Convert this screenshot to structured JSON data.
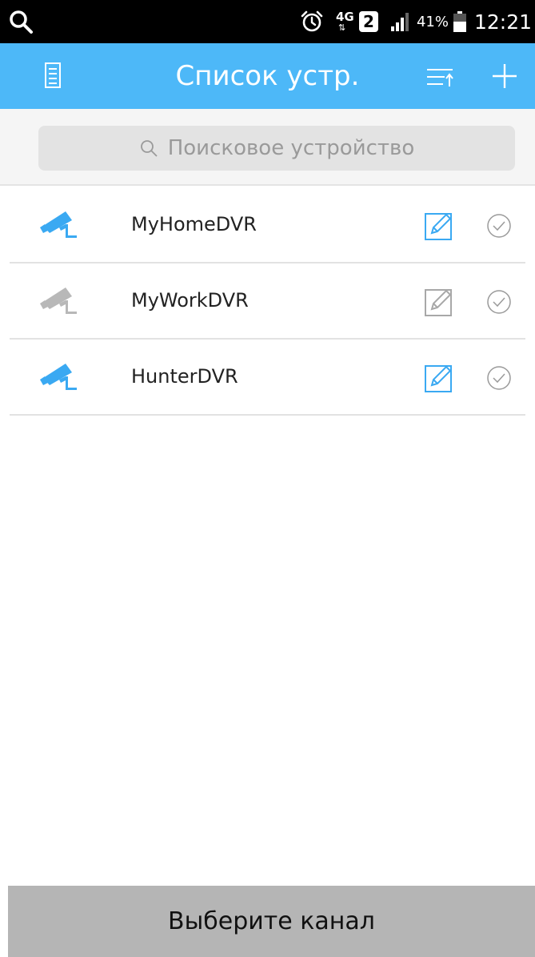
{
  "status_bar": {
    "network": "4G",
    "sim": "2",
    "battery": "41%",
    "time": "12:21"
  },
  "app_bar": {
    "title": "Список устр."
  },
  "search": {
    "placeholder": "Поисковое устройство"
  },
  "devices": [
    {
      "name": "MyHomeDVR",
      "status": "online"
    },
    {
      "name": "MyWorkDVR",
      "status": "offline"
    },
    {
      "name": "HunterDVR",
      "status": "online"
    }
  ],
  "footer": {
    "button_label": "Выберите канал"
  },
  "colors": {
    "accent": "#4db8f8",
    "online_icon": "#3aa9f2",
    "offline_icon": "#b8b8b8",
    "bottom_button": "#b5b5b5"
  },
  "icons": {
    "status_bar": [
      "search-icon",
      "alarm-icon",
      "signal-icon",
      "battery-icon"
    ],
    "app_bar": [
      "menu-list-icon",
      "sort-icon",
      "add-icon"
    ],
    "row": [
      "camera-icon",
      "edit-icon",
      "check-circle-icon"
    ]
  }
}
